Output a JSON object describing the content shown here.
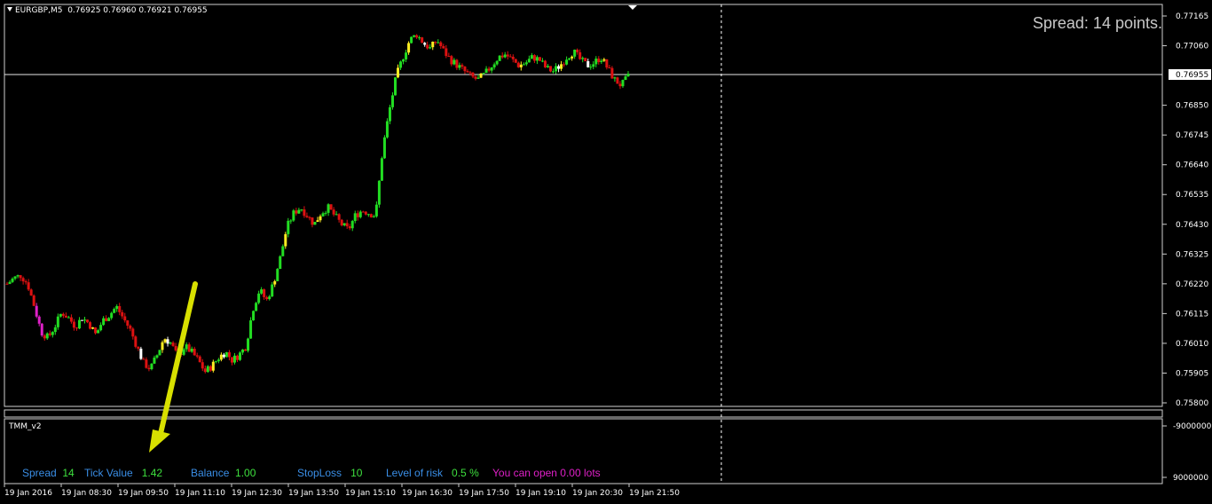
{
  "header": {
    "symbol": "EURGBP,M5",
    "ohlc": "0.76925 0.76960 0.76921 0.76955"
  },
  "overlay": {
    "spread_text": "Spread: 14 points."
  },
  "price_axis": {
    "ticks": [
      "0.77165",
      "0.77060",
      "0.76850",
      "0.76745",
      "0.76640",
      "0.76535",
      "0.76430",
      "0.76325",
      "0.76220",
      "0.76115",
      "0.76010",
      "0.75905",
      "0.75800"
    ],
    "current_price": "0.76955"
  },
  "indicator": {
    "name": "TMM_v2",
    "axis_ticks": [
      "-9000000",
      "9000000"
    ],
    "spread_label": "Spread",
    "spread_value": "14",
    "tick_label": "Tick Value",
    "tick_value": "1.42",
    "balance_label": "Balance",
    "balance_value": "1.00",
    "stoploss_label": "StopLoss",
    "stoploss_value": "10",
    "risk_label": "Level of risk",
    "risk_value": "0.5 %",
    "open_text": "You can open 0.00 lots"
  },
  "time_axis": {
    "ticks": [
      "19 Jan 2016",
      "19 Jan 08:30",
      "19 Jan 09:50",
      "19 Jan 11:10",
      "19 Jan 12:30",
      "19 Jan 13:50",
      "19 Jan 15:10",
      "19 Jan 16:30",
      "19 Jan 17:50",
      "19 Jan 19:10",
      "19 Jan 20:30",
      "19 Jan 21:50"
    ]
  },
  "colors": {
    "bull": "#22dd22",
    "bear": "#dd1111",
    "neutral_up": "#ffee22",
    "neutral_dn": "#ffffff",
    "accent": "#e020c8",
    "arrow": "#d8e000"
  },
  "chart_data": {
    "type": "candlestick",
    "ylim": [
      0.7575,
      0.7719
    ],
    "close_path": [
      0.7622,
      0.7624,
      0.7625,
      0.7622,
      0.7614,
      0.7605,
      0.7603,
      0.7607,
      0.7612,
      0.761,
      0.7607,
      0.761,
      0.7608,
      0.7604,
      0.7609,
      0.7611,
      0.7614,
      0.761,
      0.7606,
      0.76,
      0.7594,
      0.7592,
      0.7597,
      0.7603,
      0.7601,
      0.7596,
      0.76,
      0.7598,
      0.7595,
      0.7591,
      0.7593,
      0.7596,
      0.7598,
      0.7595,
      0.7597,
      0.76,
      0.7613,
      0.762,
      0.7616,
      0.7622,
      0.7631,
      0.7642,
      0.7647,
      0.7649,
      0.7646,
      0.7643,
      0.7647,
      0.7649,
      0.7646,
      0.7643,
      0.7641,
      0.7646,
      0.7648,
      0.7647,
      0.7646,
      0.7669,
      0.7683,
      0.7695,
      0.7702,
      0.7708,
      0.771,
      0.7707,
      0.7705,
      0.7708,
      0.7704,
      0.7701,
      0.7699,
      0.7697,
      0.7695,
      0.7694,
      0.7696,
      0.7699,
      0.7702,
      0.7703,
      0.7701,
      0.7699,
      0.77,
      0.7702,
      0.7701,
      0.7698,
      0.7697,
      0.7699,
      0.7702,
      0.7704,
      0.7701,
      0.7699,
      0.77,
      0.7702,
      0.7698,
      0.7694,
      0.7692,
      0.7695
    ]
  }
}
